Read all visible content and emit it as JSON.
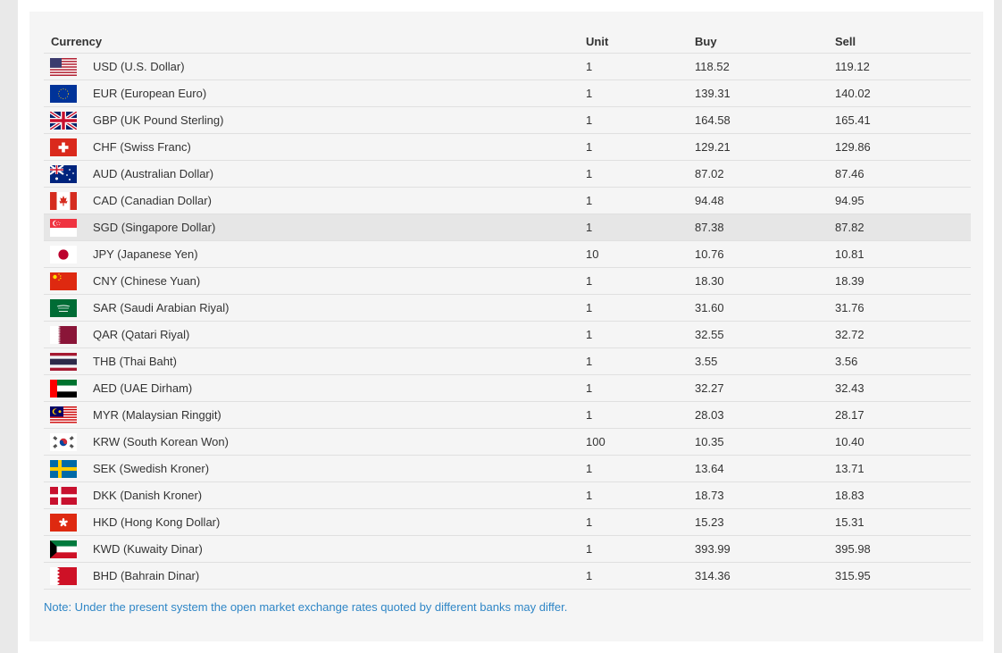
{
  "table": {
    "headers": {
      "currency": "Currency",
      "unit": "Unit",
      "buy": "Buy",
      "sell": "Sell"
    },
    "rows": [
      {
        "flag": "us-flag-icon",
        "name": "USD (U.S. Dollar)",
        "unit": "1",
        "buy": "118.52",
        "sell": "119.12"
      },
      {
        "flag": "eu-flag-icon",
        "name": "EUR (European Euro)",
        "unit": "1",
        "buy": "139.31",
        "sell": "140.02"
      },
      {
        "flag": "uk-flag-icon",
        "name": "GBP (UK Pound Sterling)",
        "unit": "1",
        "buy": "164.58",
        "sell": "165.41"
      },
      {
        "flag": "swiss-flag-icon",
        "name": "CHF (Swiss Franc)",
        "unit": "1",
        "buy": "129.21",
        "sell": "129.86"
      },
      {
        "flag": "australia-flag-icon",
        "name": "AUD (Australian Dollar)",
        "unit": "1",
        "buy": "87.02",
        "sell": "87.46"
      },
      {
        "flag": "canada-flag-icon",
        "name": "CAD (Canadian Dollar)",
        "unit": "1",
        "buy": "94.48",
        "sell": "94.95"
      },
      {
        "flag": "singapore-flag-icon",
        "name": "SGD (Singapore Dollar)",
        "unit": "1",
        "buy": "87.38",
        "sell": "87.82"
      },
      {
        "flag": "japan-flag-icon",
        "name": "JPY (Japanese Yen)",
        "unit": "10",
        "buy": "10.76",
        "sell": "10.81"
      },
      {
        "flag": "china-flag-icon",
        "name": "CNY (Chinese Yuan)",
        "unit": "1",
        "buy": "18.30",
        "sell": "18.39"
      },
      {
        "flag": "saudi-flag-icon",
        "name": "SAR (Saudi Arabian Riyal)",
        "unit": "1",
        "buy": "31.60",
        "sell": "31.76"
      },
      {
        "flag": "qatar-flag-icon",
        "name": "QAR (Qatari Riyal)",
        "unit": "1",
        "buy": "32.55",
        "sell": "32.72"
      },
      {
        "flag": "thailand-flag-icon",
        "name": "THB (Thai Baht)",
        "unit": "1",
        "buy": "3.55",
        "sell": "3.56"
      },
      {
        "flag": "uae-flag-icon",
        "name": "AED (UAE Dirham)",
        "unit": "1",
        "buy": "32.27",
        "sell": "32.43"
      },
      {
        "flag": "malaysia-flag-icon",
        "name": "MYR (Malaysian Ringgit)",
        "unit": "1",
        "buy": "28.03",
        "sell": "28.17"
      },
      {
        "flag": "south-korea-flag-icon",
        "name": "KRW (South Korean Won)",
        "unit": "100",
        "buy": "10.35",
        "sell": "10.40"
      },
      {
        "flag": "sweden-flag-icon",
        "name": "SEK (Swedish Kroner)",
        "unit": "1",
        "buy": "13.64",
        "sell": "13.71"
      },
      {
        "flag": "denmark-flag-icon",
        "name": "DKK (Danish Kroner)",
        "unit": "1",
        "buy": "18.73",
        "sell": "18.83"
      },
      {
        "flag": "hong-kong-flag-icon",
        "name": "HKD (Hong Kong Dollar)",
        "unit": "1",
        "buy": "15.23",
        "sell": "15.31"
      },
      {
        "flag": "kuwait-flag-icon",
        "name": "KWD (Kuwaity Dinar)",
        "unit": "1",
        "buy": "393.99",
        "sell": "395.98"
      },
      {
        "flag": "bahrain-flag-icon",
        "name": "BHD (Bahrain Dinar)",
        "unit": "1",
        "buy": "314.36",
        "sell": "315.95"
      }
    ]
  },
  "note": "Note: Under the present system the open market exchange rates quoted by different banks may differ.",
  "colors": {
    "note_text": "#2f86c6",
    "highlight_row": "#e6e6e6",
    "panel_bg": "#f5f5f5"
  }
}
